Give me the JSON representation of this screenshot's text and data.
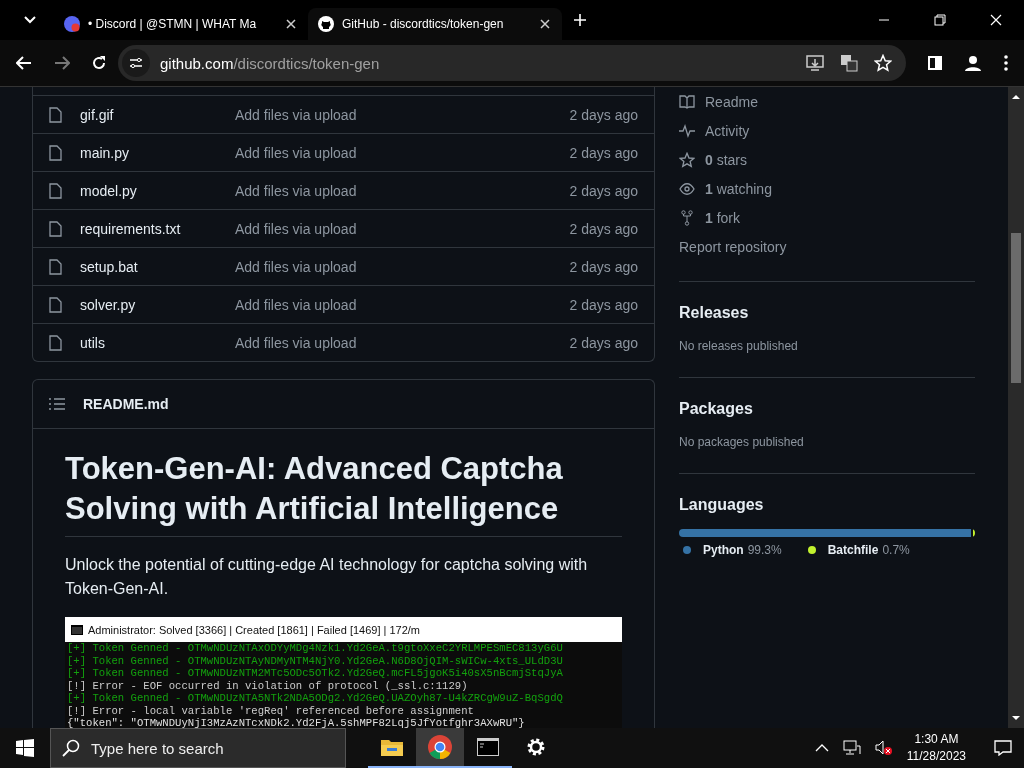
{
  "browser": {
    "tabs": [
      {
        "title": "• Discord | @STMN | WHAT Ma",
        "selected": false
      },
      {
        "title": "GitHub - discordtics/token-gen",
        "selected": true
      }
    ],
    "address": {
      "domain": "github.com",
      "path": "/discordtics/token-gen"
    }
  },
  "files": [
    {
      "name": "gif.gif",
      "message": "Add files via upload",
      "time": "2 days ago"
    },
    {
      "name": "main.py",
      "message": "Add files via upload",
      "time": "2 days ago"
    },
    {
      "name": "model.py",
      "message": "Add files via upload",
      "time": "2 days ago"
    },
    {
      "name": "requirements.txt",
      "message": "Add files via upload",
      "time": "2 days ago"
    },
    {
      "name": "setup.bat",
      "message": "Add files via upload",
      "time": "2 days ago"
    },
    {
      "name": "solver.py",
      "message": "Add files via upload",
      "time": "2 days ago"
    },
    {
      "name": "utils",
      "message": "Add files via upload",
      "time": "2 days ago"
    }
  ],
  "readme": {
    "file": "README.md",
    "heading": "Token-Gen-AI: Advanced Captcha Solving with Artificial Intelligence",
    "paragraph": "Unlock the potential of cutting-edge AI technology for captcha solving with Token-Gen-AI.",
    "console": {
      "title": "Administrator:  Solved [3366] | Created [1861] | Failed [1469] | 172/m",
      "lines": [
        {
          "kind": "ok",
          "text": "[+] Token Genned - OTMwNDUzNTAxODYyMDg4Nzk1.Yd2GeA.t9gtoXxeC2YRLMPESmEC813yG6U"
        },
        {
          "kind": "ok",
          "text": "[+] Token Genned - OTMwNDUzNTAyNDMyNTM4NjY0.Yd2GeA.N6D8OjQIM-sWICw-4xts_ULdD3U"
        },
        {
          "kind": "ok",
          "text": "[+] Token Genned - OTMwNDUzNTM2MTc5ODc5OTk2.Yd2GeQ.mcFL5jgoK5i40sX5nBcmjStqJyA"
        },
        {
          "kind": "error",
          "text": "[!] Error - EOF occurred in violation of protocol (_ssl.c:1129)"
        },
        {
          "kind": "ok",
          "text": "[+] Token Genned - OTMwNDUzNTA5NTk2NDA5ODg2.Yd2GeQ.UAZOyh87-U4kZRCgW9uZ-BqSgdQ"
        },
        {
          "kind": "error",
          "text": "[!] Error - local variable 'regReq' referenced before assignment"
        },
        {
          "kind": "json",
          "text": "{\"token\": \"OTMwNDUyNjI3MzAzNTcxNDk2.Yd2FjA.5shMPF82Lqj5JfYotfghr3AXwRU\"}"
        }
      ]
    }
  },
  "sidebar": {
    "about": [
      {
        "text": "Readme"
      },
      {
        "text": "Activity"
      },
      {
        "text": "**0** stars"
      },
      {
        "text": "**1** watching"
      },
      {
        "text": "**1** fork"
      },
      {
        "text": "Report repository"
      }
    ],
    "sections": [
      {
        "title": "Releases",
        "note": "No releases published"
      },
      {
        "title": "Packages",
        "note": "No packages published"
      }
    ],
    "languages": {
      "title": "Languages",
      "items": [
        {
          "name": "Python",
          "percent": "99.3%",
          "color": "#3572a5",
          "level": 0.993
        },
        {
          "name": "Batchfile",
          "percent": "0.7%",
          "color": "#c1f12e",
          "level": 0.007
        }
      ]
    }
  },
  "taskbar": {
    "search": {
      "placeholder": "Type here to search"
    },
    "apps": [
      {
        "running": true,
        "selected": false
      },
      {
        "running": true,
        "selected": true
      },
      {
        "running": true,
        "selected": false
      },
      {
        "running": false,
        "selected": false
      }
    ],
    "time": "1:30 AM",
    "date": "11/28/2023"
  }
}
